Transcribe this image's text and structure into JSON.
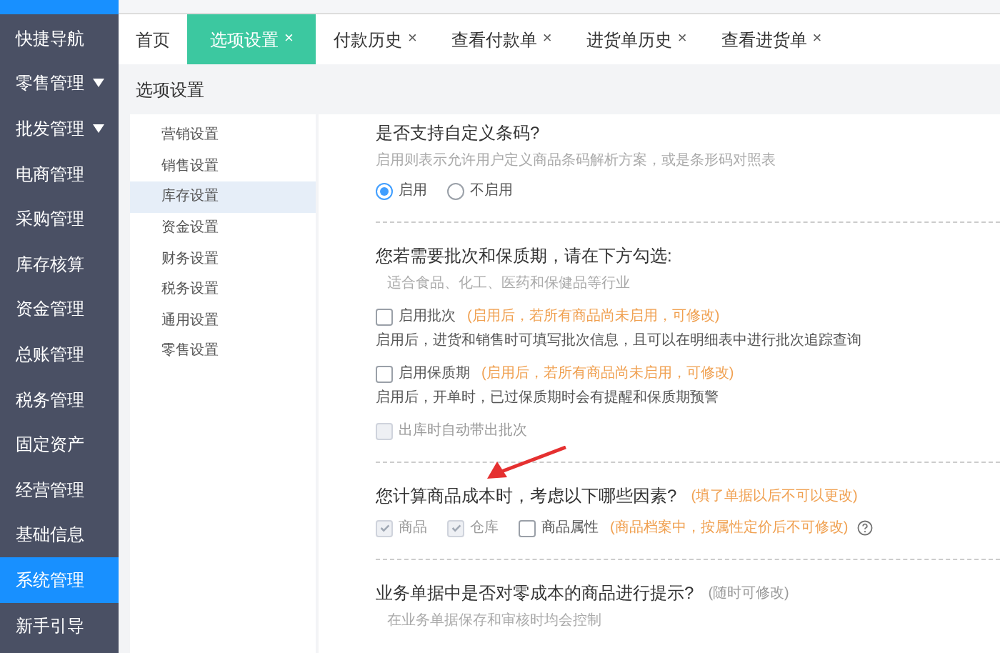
{
  "sidebar": {
    "items": [
      {
        "label": "快捷导航",
        "selected": false,
        "expandable": false
      },
      {
        "label": "零售管理",
        "selected": false,
        "expandable": true
      },
      {
        "label": "批发管理",
        "selected": false,
        "expandable": true
      },
      {
        "label": "电商管理",
        "selected": false,
        "expandable": false
      },
      {
        "label": "采购管理",
        "selected": false,
        "expandable": false
      },
      {
        "label": "库存核算",
        "selected": false,
        "expandable": false
      },
      {
        "label": "资金管理",
        "selected": false,
        "expandable": false
      },
      {
        "label": "总账管理",
        "selected": false,
        "expandable": false
      },
      {
        "label": "税务管理",
        "selected": false,
        "expandable": false
      },
      {
        "label": "固定资产",
        "selected": false,
        "expandable": false
      },
      {
        "label": "经营管理",
        "selected": false,
        "expandable": false
      },
      {
        "label": "基础信息",
        "selected": false,
        "expandable": false
      },
      {
        "label": "系统管理",
        "selected": true,
        "expandable": false
      },
      {
        "label": "新手引导",
        "selected": false,
        "expandable": false
      }
    ]
  },
  "tabs": [
    {
      "label": "首页",
      "selected": false,
      "closable": false
    },
    {
      "label": "选项设置",
      "selected": true,
      "closable": true
    },
    {
      "label": "付款历史",
      "selected": false,
      "closable": true
    },
    {
      "label": "查看付款单",
      "selected": false,
      "closable": true
    },
    {
      "label": "进货单历史",
      "selected": false,
      "closable": true
    },
    {
      "label": "查看进货单",
      "selected": false,
      "closable": true
    }
  ],
  "close_glyph": "×",
  "page_title": "选项设置",
  "settings_menu": [
    {
      "label": "营销设置",
      "selected": false
    },
    {
      "label": "销售设置",
      "selected": false
    },
    {
      "label": "库存设置",
      "selected": true
    },
    {
      "label": "资金设置",
      "selected": false
    },
    {
      "label": "财务设置",
      "selected": false
    },
    {
      "label": "税务设置",
      "selected": false
    },
    {
      "label": "通用设置",
      "selected": false
    },
    {
      "label": "零售设置",
      "selected": false
    }
  ],
  "sections": [
    {
      "title": "是否支持自定义条码?",
      "hint": "启用则表示允许用户定义商品条码解析方案，或是条形码对照表",
      "options": [
        {
          "kind": "radio",
          "label": "启用",
          "selected": true,
          "disabled": false
        },
        {
          "kind": "radio",
          "label": "不启用",
          "selected": false,
          "disabled": false
        }
      ]
    },
    {
      "title": "您若需要批次和保质期，请在下方勾选:",
      "hint": "适合食品、化工、医药和保健品等行业",
      "options": [
        {
          "kind": "checkbox-row",
          "label": "启用批次",
          "checked": false,
          "disabled": false,
          "note": "(启用后，若所有商品尚未启用，可修改)",
          "description": "启用后，进货和销售时可填写批次信息，且可以在明细表中进行批次追踪查询"
        },
        {
          "kind": "checkbox-row",
          "label": "启用保质期",
          "checked": false,
          "disabled": false,
          "note": "(启用后，若所有商品尚未启用，可修改)",
          "description": "启用后，开单时，已过保质期时会有提醒和保质期预警"
        },
        {
          "kind": "checkbox-row",
          "label": "出库时自动带出批次",
          "checked": false,
          "disabled": true
        }
      ]
    },
    {
      "title": "您计算商品成本时，考虑以下哪些因素?",
      "note": "(填了单据以后不可以更改)",
      "options": [
        {
          "kind": "checkbox",
          "label": "商品",
          "checked": true,
          "disabled": true
        },
        {
          "kind": "checkbox",
          "label": "仓库",
          "checked": true,
          "disabled": true
        },
        {
          "kind": "checkbox",
          "label": "商品属性",
          "checked": false,
          "disabled": false,
          "note": "(商品档案中，按属性定价后不可修改)",
          "help": true
        }
      ]
    },
    {
      "title": "业务单据中是否对零成本的商品进行提示?",
      "note": "(随时可修改)",
      "hint": "在业务单据保存和审核时均会控制"
    }
  ]
}
